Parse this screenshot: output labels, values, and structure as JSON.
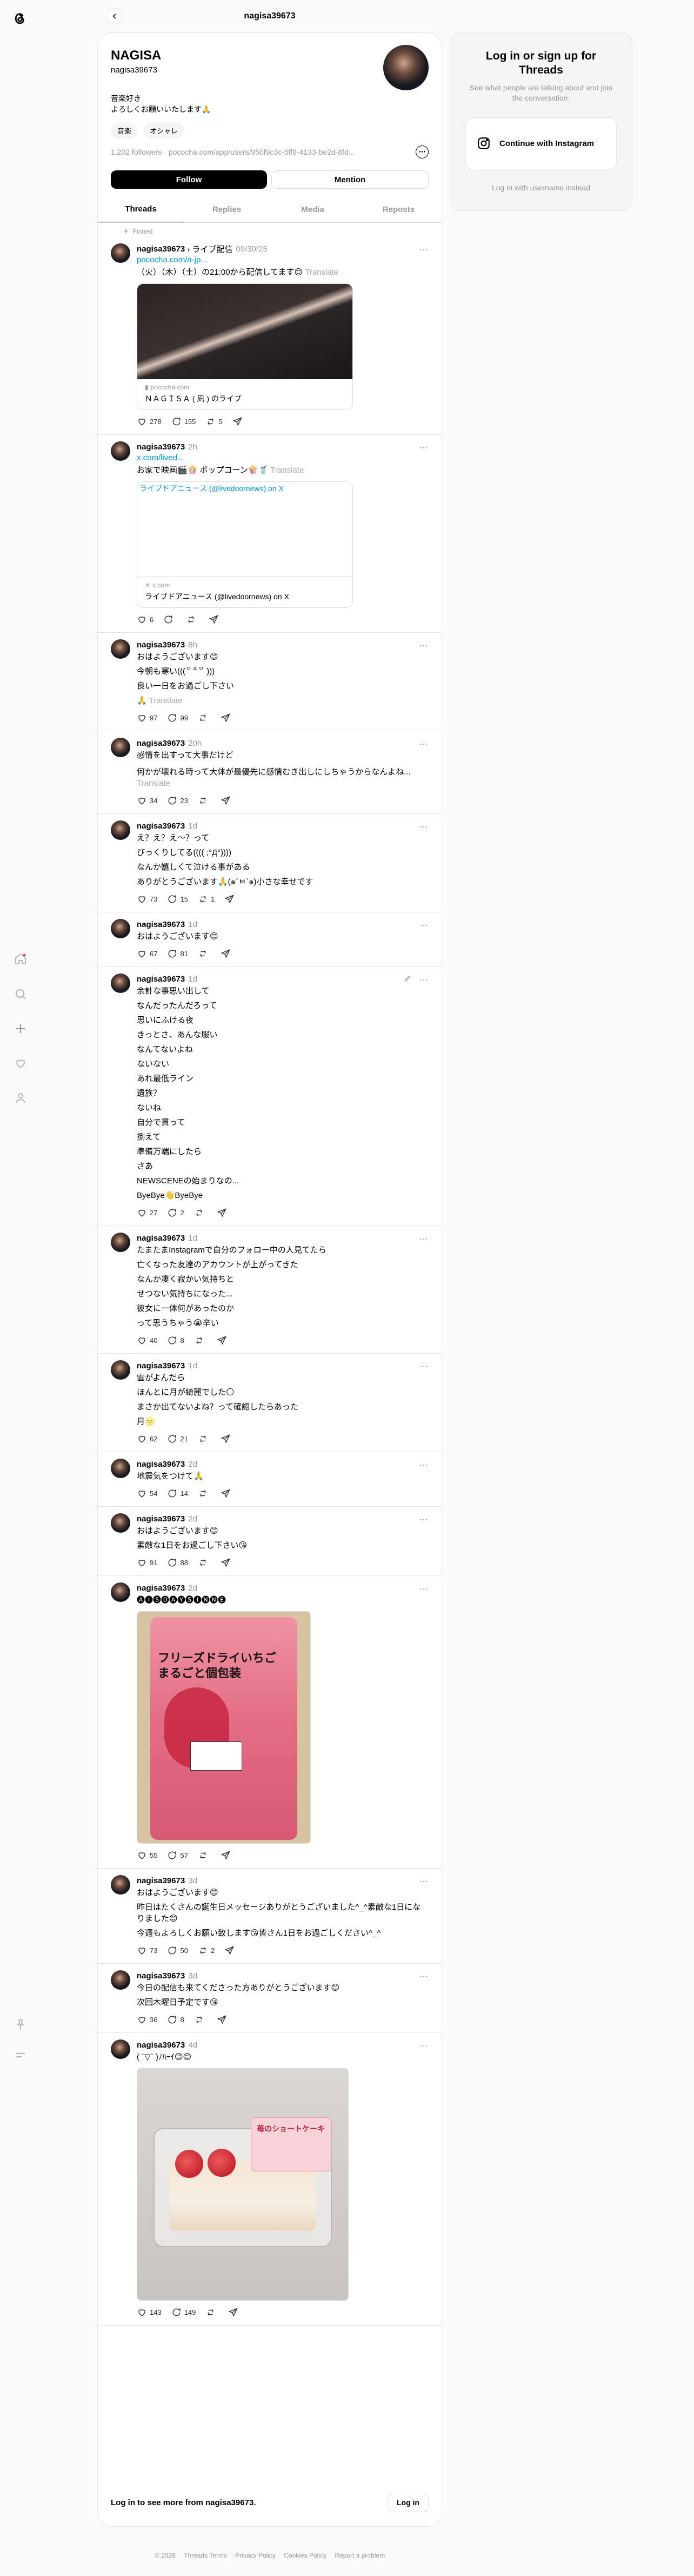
{
  "header": {
    "handle": "nagisa39673"
  },
  "profile": {
    "name": "NAGISA",
    "username": "nagisa39673",
    "bio": [
      "音楽好き",
      "よろしくお願いいたします🙏"
    ],
    "tags": [
      "音楽",
      "オシャレ"
    ],
    "followers": "1,202 followers",
    "link": "pococha.com/app/users/950f9c3c-5ff8-4133-be2d-8fd...",
    "follow_label": "Follow",
    "mention_label": "Mention"
  },
  "tabs": [
    "Threads",
    "Replies",
    "Media",
    "Reposts"
  ],
  "pinned_label": "Pinned",
  "posts": [
    {
      "user": "nagisa39673",
      "topic": "› ライブ配信",
      "time": "09/30/25",
      "link": "pococha.com/a-jp...",
      "lines": [
        "（火）（木）（土）の21:00から配信してます😊"
      ],
      "translate": "Translate",
      "card_domain": "pococha.com",
      "card_title": "ＮＡＧＩＳＡ ( 凪 ) のライブ",
      "likes": "278",
      "replies": "155",
      "reposts": "5"
    },
    {
      "user": "nagisa39673",
      "time": "2h",
      "link": "x.com/lived...",
      "lines": [
        "お家で映画🎬🍿 ポップコーン🍿🥤"
      ],
      "translate": "Translate",
      "card_alt": "ライブドアニュース (@livedoornews) on X",
      "card_domain": "x.com",
      "card_title": "ライブドアニュース (@livedoornews) on X",
      "likes": "6",
      "replies": "",
      "reposts": ""
    },
    {
      "user": "nagisa39673",
      "time": "8h",
      "lines": [
        "おはようございます😊",
        "今朝も寒い(((꒪꒫꒪ )))",
        "良い一日をお過ごし下さい",
        "🙏"
      ],
      "translate": "Translate",
      "likes": "97",
      "replies": "99",
      "reposts": ""
    },
    {
      "user": "nagisa39673",
      "time": "20h",
      "lines": [
        "感情を出すって大事だけど",
        "何かが壊れる時って大体が最優先に感情むき出しにしちゃうからなんよね..."
      ],
      "translate": "Translate",
      "likes": "34",
      "replies": "23",
      "reposts": ""
    },
    {
      "user": "nagisa39673",
      "time": "1d",
      "lines": [
        "え？え？え〜？って",
        "びっくりしてる(((( ;°Д°))))",
        "なんか嬉しくて泣ける事がある",
        "ありがとうございます🙏(๑´ㅂ`๑)小さな幸せです"
      ],
      "likes": "73",
      "replies": "15",
      "reposts": "1"
    },
    {
      "user": "nagisa39673",
      "time": "1d",
      "lines": [
        "おはようございます😊"
      ],
      "likes": "67",
      "replies": "81",
      "reposts": ""
    },
    {
      "user": "nagisa39673",
      "time": "1d",
      "lines": [
        "余計な事思い出して",
        "なんだったんだろって",
        "思いにふける夜",
        "きっとさ、あんな服い",
        "なんてないよね",
        "ないない",
        "あれ最低ライン",
        "遺族？",
        "ないね",
        "自分で貫って",
        "捌えて",
        "準備万端にしたら",
        "さあ",
        "NEWSCENEの始まりなの...",
        "ByeBye👋ByeBye"
      ],
      "likes": "27",
      "replies": "2",
      "reposts": ""
    },
    {
      "user": "nagisa39673",
      "time": "1d",
      "lines": [
        "たまたまInstagramで自分のフォロー中の人見てたら",
        "亡くなった友達のアカウントが上がってきた",
        "なんか凄く寂かい気持ちと",
        "せつない気持ちになった...",
        "彼女に一体何があったのか",
        "って思うちゃう😭辛い"
      ],
      "likes": "40",
      "replies": "8",
      "reposts": ""
    },
    {
      "user": "nagisa39673",
      "time": "1d",
      "lines": [
        "雲がよんだら",
        "ほんとに月が綺麗でした🌕",
        "まさか出てないよね？って確認したらあった",
        "月🌝"
      ],
      "likes": "62",
      "replies": "21",
      "reposts": ""
    },
    {
      "user": "nagisa39673",
      "time": "2d",
      "lines": [
        "地震気をつけて🙏"
      ],
      "likes": "54",
      "replies": "14",
      "reposts": ""
    },
    {
      "user": "nagisa39673",
      "time": "2d",
      "lines": [
        "おはようございます😊",
        "素敵な1日をお過ごし下さい😘"
      ],
      "likes": "91",
      "replies": "88",
      "reposts": ""
    },
    {
      "user": "nagisa39673",
      "time": "2d",
      "lines": [
        "🅐🅘🅢🅓🅐🅨🅢🅘🅝🅝🅔"
      ],
      "photo_text": "フリーズドライいちご まるごと個包装",
      "likes": "55",
      "replies": "57",
      "reposts": ""
    },
    {
      "user": "nagisa39673",
      "time": "3d",
      "lines": [
        "おはようございます😊",
        "昨日はたくさんの誕生日メッセージありがとうございました^_^素敵な1日になりました😊",
        "今週もよろしくお願い致します😘皆さん1日をお過ごしください^_^"
      ],
      "likes": "73",
      "replies": "50",
      "reposts": "2"
    },
    {
      "user": "nagisa39673",
      "time": "3d",
      "lines": [
        "今日の配信も来てくださった方ありがとうございます😊",
        "次回木曜日予定です😘"
      ],
      "likes": "36",
      "replies": "8",
      "reposts": ""
    },
    {
      "user": "nagisa39673",
      "time": "4d",
      "lines": [
        "(  ´▽` )ﾉﾊｰｲ😊😊"
      ],
      "photo_text": "苺のショートケーキ",
      "likes": "143",
      "replies": "149",
      "reposts": ""
    }
  ],
  "bottom": {
    "message": "Log in to see more from nagisa39673.",
    "login": "Log in"
  },
  "sidecard": {
    "title": "Log in or sign up for Threads",
    "subtitle": "See what people are talking about and join the conversation.",
    "instagram": "Continue with Instagram",
    "alt": "Log in with username instead"
  },
  "footer": [
    "© 2026",
    "Threads Terms",
    "Privacy Policy",
    "Cookies Policy",
    "Report a problem"
  ],
  "icons": [
    "threads-logo-icon",
    "home-icon",
    "search-icon",
    "create-icon",
    "heart-icon",
    "profile-icon",
    "pin-icon",
    "menu-icon"
  ],
  "colors": {
    "accent": "#0095f6",
    "muted": "#999999",
    "notif": "#ff3040"
  }
}
